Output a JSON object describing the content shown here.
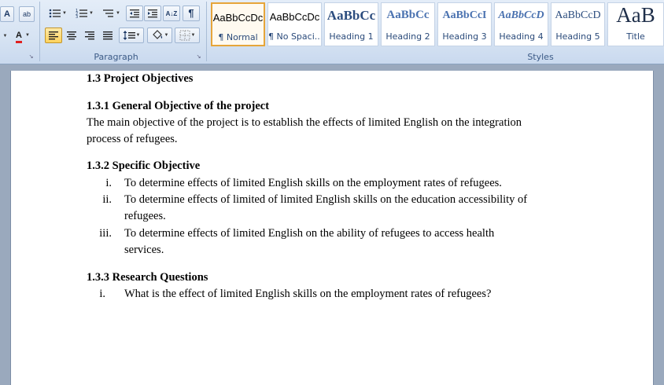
{
  "ribbon": {
    "font_group": {
      "font_size_label": "A",
      "font_size_caret": "ˆ",
      "clear_format": "A",
      "highlight_label": "ab",
      "font_color_label": "A"
    },
    "paragraph_group": {
      "label": "Paragraph",
      "sort_label": "A↓Z",
      "pilcrow": "¶"
    },
    "styles_group": {
      "label": "Styles",
      "styles": [
        {
          "sample": "AaBbCcDc",
          "name": "¶ Normal"
        },
        {
          "sample": "AaBbCcDc",
          "name": "¶ No Spaci..."
        },
        {
          "sample": "AaBbCc",
          "name": "Heading 1"
        },
        {
          "sample": "AaBbCc",
          "name": "Heading 2"
        },
        {
          "sample": "AaBbCcI",
          "name": "Heading 3"
        },
        {
          "sample": "AaBbCcD",
          "name": "Heading 4"
        },
        {
          "sample": "AaBbCcD",
          "name": "Heading 5"
        },
        {
          "sample": "AaB",
          "name": "Title"
        }
      ]
    }
  },
  "document": {
    "h_project_objectives": "1.3 Project Objectives",
    "h_general_objective": "1.3.1 General Objective of the project",
    "general_line1": "The main objective of the project is to establish the effects of limited English on the integration",
    "general_line2": "process of refugees.",
    "h_specific_objective": "1.3.2 Specific Objective",
    "specific_items": [
      {
        "num": "i.",
        "line1": "To determine effects of limited English skills on the employment rates of refugees.",
        "line2": ""
      },
      {
        "num": "ii.",
        "line1": "To determine effects of limited of limited English skills on the education accessibility of",
        "line2": "refugees."
      },
      {
        "num": "iii.",
        "line1": "To determine effects of limited English on the ability of refugees to access health",
        "line2": "services."
      }
    ],
    "h_research_questions": "1.3.3 Research Questions",
    "question_items": [
      {
        "num": "i.",
        "line1": "What is the effect of limited English skills on the employment rates of refugees?"
      }
    ]
  }
}
